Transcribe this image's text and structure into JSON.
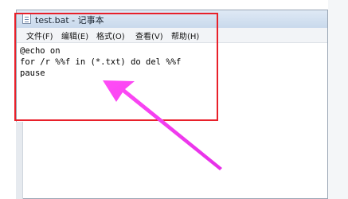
{
  "window": {
    "title": "test.bat - 记事本",
    "menu": [
      {
        "label": "文件(F)"
      },
      {
        "label": "编辑(E)"
      },
      {
        "label": "格式(O)"
      },
      {
        "label": "查看(V)"
      },
      {
        "label": "帮助(H)"
      }
    ]
  },
  "editor": {
    "lines": [
      "@echo on",
      "for /r %%f in (*.txt) do del %%f",
      "pause"
    ]
  },
  "colors": {
    "highlight_border": "#e8202a",
    "arrow": "#ee3cf0"
  }
}
